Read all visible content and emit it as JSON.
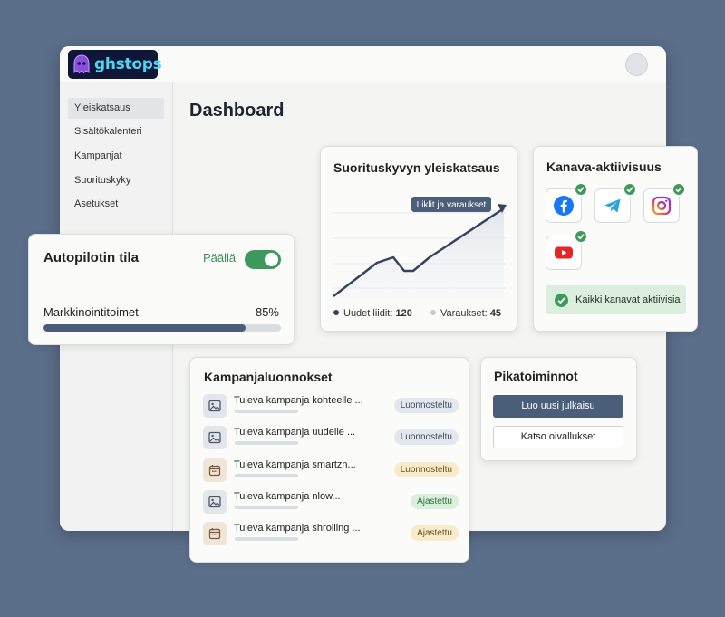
{
  "brand": {
    "logo_text": "ghstops"
  },
  "sidebar": {
    "items": [
      {
        "label": "Yleiskatsaus",
        "active": true
      },
      {
        "label": "Sisältökalenteri",
        "active": false
      },
      {
        "label": "Kampanjat",
        "active": false
      },
      {
        "label": "Suorituskyky",
        "active": false
      },
      {
        "label": "Asetukset",
        "active": false
      }
    ]
  },
  "main": {
    "title": "Dashboard"
  },
  "performance": {
    "title": "Suorituskyvyn yleiskatsaus",
    "tooltip": "Liklit ja varaukset",
    "legend": [
      {
        "label": "Uudet liidit:",
        "value": "120",
        "color": "#34445e"
      },
      {
        "label": "Varaukset:",
        "value": "45",
        "color": "#c8ccd2"
      }
    ]
  },
  "channels": {
    "title": "Kanava-aktiivisuus",
    "items": [
      {
        "icon": "facebook-icon",
        "active": true,
        "color": "#1877f2"
      },
      {
        "icon": "telegram-icon",
        "active": true,
        "color": "#2aa3df"
      },
      {
        "icon": "instagram-icon",
        "active": true,
        "color": "#d6316f"
      },
      {
        "icon": "youtube-icon",
        "active": true,
        "color": "#e32626"
      }
    ],
    "status": "Kaikki kanavat aktiivisia"
  },
  "autopilot": {
    "title": "Autopilotin tila",
    "status": "Päällä",
    "enabled": true,
    "progress_label": "Markkinointitoimet",
    "progress_value": "85%",
    "progress_fraction": 0.85
  },
  "drafts": {
    "title": "Kampanjaluonnokset",
    "items": [
      {
        "title": "Tuleva kampanja kohteelle ...",
        "status": "Luonnosteltu",
        "icon": "image-icon",
        "badge": "draft"
      },
      {
        "title": "Tuleva kampanja uudelle ...",
        "status": "Luonnosteltu",
        "icon": "image-icon",
        "badge": "draft"
      },
      {
        "title": "Tuleva kampanja smartzn...",
        "status": "Luonnosteltu",
        "icon": "calendar-icon",
        "badge": "draft-y"
      },
      {
        "title": "Tuleva kampanja nlow...",
        "status": "Ajastettu",
        "icon": "image-icon",
        "badge": "sched"
      },
      {
        "title": "Tuleva kampanja shrolling ...",
        "status": "Ajastettu",
        "icon": "calendar-icon",
        "badge": "sched-y"
      }
    ]
  },
  "quick_actions": {
    "title": "Pikatoiminnot",
    "primary": "Luo uusi julkaisu",
    "secondary": "Katso oivallukset"
  }
}
